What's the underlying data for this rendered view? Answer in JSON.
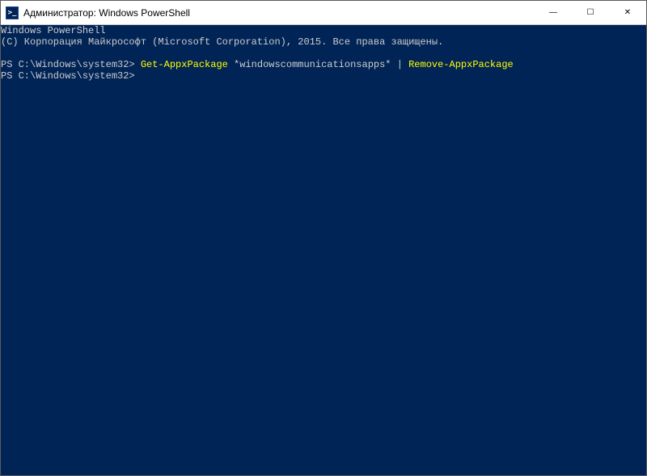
{
  "window": {
    "title": "Администратор: Windows PowerShell",
    "controls": {
      "minimize": "—",
      "maximize": "☐",
      "close": "✕"
    }
  },
  "terminal": {
    "lines": [
      {
        "type": "plain",
        "text": "Windows PowerShell"
      },
      {
        "type": "plain",
        "text": "(C) Корпорация Майкрософт (Microsoft Corporation), 2015. Все права защищены."
      },
      {
        "type": "blank",
        "text": ""
      },
      {
        "type": "command",
        "prompt": "PS C:\\Windows\\system32> ",
        "segments": [
          {
            "text": "Get-AppxPackage",
            "style": "cmd-yellow"
          },
          {
            "text": " *windowscommunicationsapps* ",
            "style": "cmd-white"
          },
          {
            "text": "|",
            "style": "cmd-white"
          },
          {
            "text": " ",
            "style": "cmd-white"
          },
          {
            "text": "Remove-AppxPackage",
            "style": "cmd-yellow"
          }
        ]
      },
      {
        "type": "prompt-only",
        "prompt": "PS C:\\Windows\\system32> "
      }
    ]
  }
}
